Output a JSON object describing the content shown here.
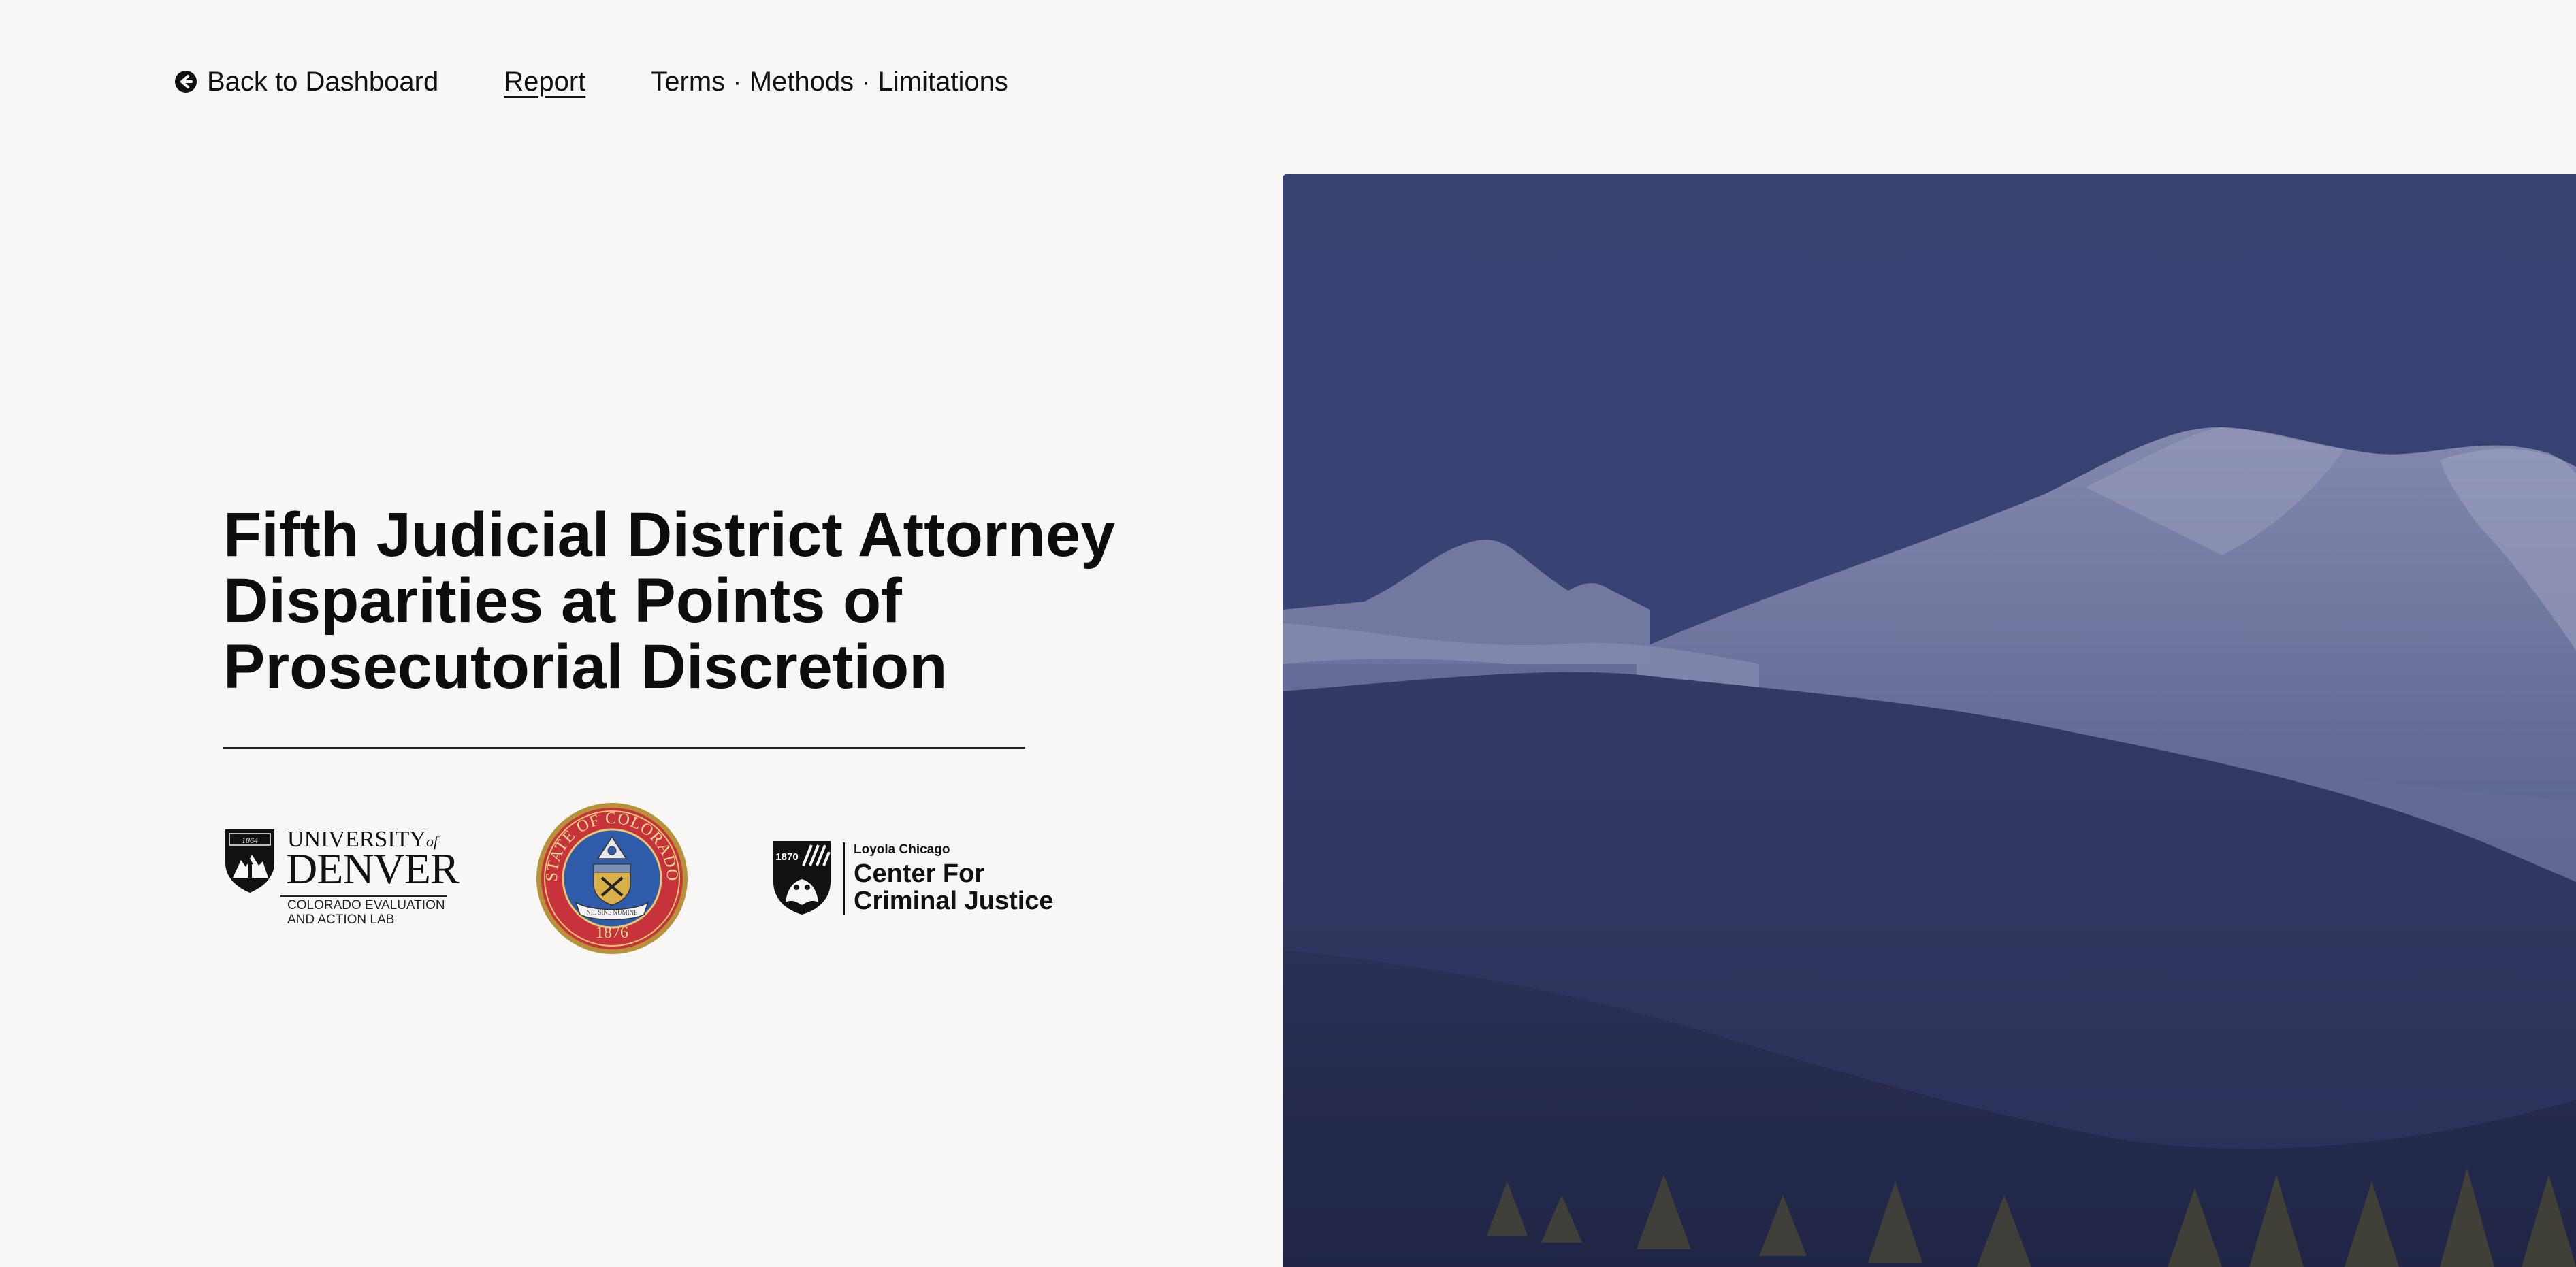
{
  "nav": {
    "back_label": "Back to Dashboard",
    "back_icon": "arrow-left-circle-icon",
    "report_label": "Report",
    "terms_label": "Terms · Methods · Limitations"
  },
  "title": {
    "lines": [
      "Fifth Judicial District Attorney",
      "Disparities at Points of",
      "Prosecutorial Discretion"
    ]
  },
  "logos": {
    "denver": {
      "university": "UNIVERSITY",
      "of": "of",
      "name": "DENVER",
      "lab_line1": "COLORADO EVALUATION",
      "lab_line2": "AND ACTION LAB",
      "shield_year": "1864",
      "icon": "university-of-denver-shield-icon"
    },
    "colorado": {
      "arc_text": "STATE OF COLORADO",
      "banner": "NIL SINE NUMINE",
      "year": "1876",
      "icon": "colorado-state-seal-icon"
    },
    "loyola": {
      "small": "Loyola Chicago",
      "line1": "Center For",
      "line2": "Criminal Justice",
      "shield_year": "1870",
      "icon": "loyola-shield-icon"
    }
  },
  "hero": {
    "icon": "mountain-landscape-image",
    "overlay_color": "#3b4577"
  }
}
